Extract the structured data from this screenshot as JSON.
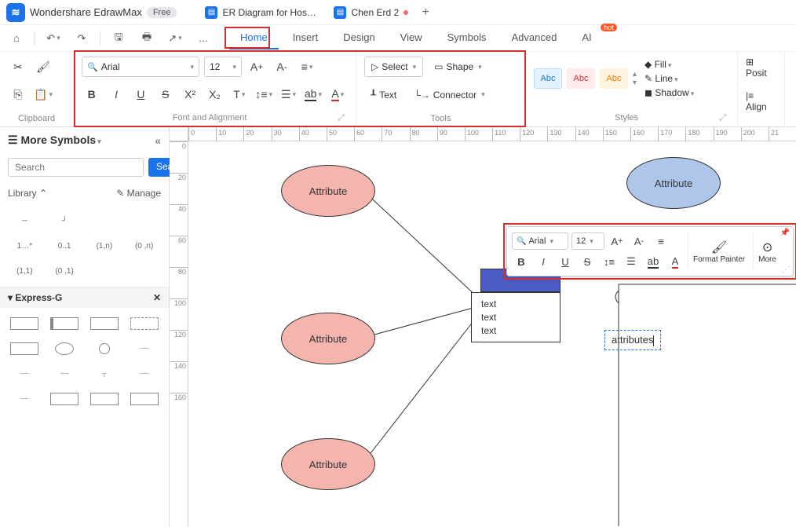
{
  "app": {
    "name": "Wondershare EdrawMax",
    "badge": "Free",
    "logo_glyph": "≋"
  },
  "tabs": [
    {
      "label": "ER Diagram for Hosp..."
    },
    {
      "label": "Chen Erd 2",
      "dirty": true
    }
  ],
  "menu": {
    "home": "Home",
    "insert": "Insert",
    "design": "Design",
    "view": "View",
    "symbols": "Symbols",
    "advanced": "Advanced",
    "ai": "AI",
    "hot": "hot"
  },
  "ribbon": {
    "clipboard_label": "Clipboard",
    "font_group_label": "Font and Alignment",
    "tools_group_label": "Tools",
    "styles_group_label": "Styles",
    "font_name": "Arial",
    "font_size": "12",
    "select_label": "Select",
    "shape_label": "Shape",
    "text_label": "Text",
    "connector_label": "Connector",
    "swatch": "Abc",
    "fill": "Fill",
    "line": "Line",
    "shadow": "Shadow",
    "posit": "Posit",
    "align": "Align"
  },
  "side": {
    "title": "More Symbols",
    "search_ph": "Search",
    "search_btn": "Search",
    "library": "Library",
    "manage": "Manage",
    "cardinality": [
      "",
      "",
      "",
      "",
      "1…*",
      "0..1",
      "(1,n)",
      "(0 ,n)",
      "(1,1)",
      "(0 ,1)"
    ],
    "express_g": "Express-G"
  },
  "ruler_h": [
    0,
    10,
    20,
    30,
    40,
    50,
    60,
    70,
    80,
    90,
    100,
    110,
    120,
    130,
    140,
    150,
    160,
    170,
    180,
    190,
    200,
    21
  ],
  "ruler_v": [
    0,
    20,
    40,
    60,
    80,
    100,
    120,
    140,
    160
  ],
  "canvas": {
    "attr1": "Attribute",
    "attr2": "Attribute",
    "attr3": "Attribute",
    "attr4": "Attribute",
    "textbox": [
      "text",
      "text",
      "text"
    ],
    "edit_text": "attributes"
  },
  "float": {
    "font_name": "Arial",
    "font_size": "12",
    "format_painter": "Format Painter",
    "more": "More"
  }
}
